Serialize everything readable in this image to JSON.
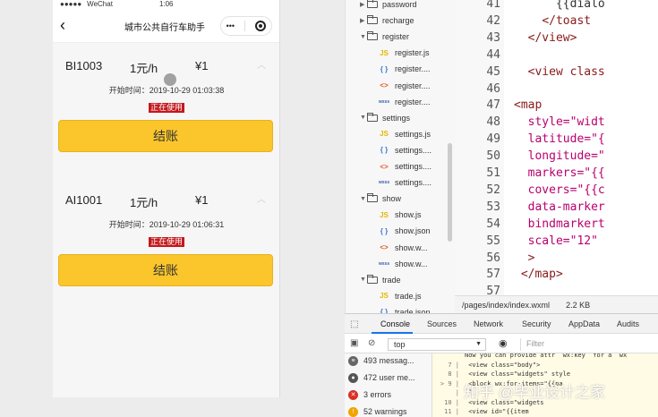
{
  "phone": {
    "status": {
      "carrier": "WeChat",
      "time": "1:06",
      "battery": ""
    },
    "nav": {
      "back_glyph": "‹",
      "title": "城市公共自行车助手",
      "more_glyph": "•••"
    },
    "cards": [
      {
        "id": "BI1003",
        "price": "1元/h",
        "amount": "¥1",
        "start": "开始时间：2019-10-29 01:03:38",
        "status": "正在使用",
        "button": "结账"
      },
      {
        "id": "AI1001",
        "price": "1元/h",
        "amount": "¥1",
        "start": "开始时间：2019-10-29 01:06:31",
        "status": "正在使用",
        "button": "结账"
      }
    ]
  },
  "filetree": [
    {
      "label": "password",
      "kind": "folder",
      "open": false
    },
    {
      "label": "recharge",
      "kind": "folder",
      "open": false
    },
    {
      "label": "register",
      "kind": "folder",
      "open": true
    },
    {
      "label": "register.js",
      "kind": "js"
    },
    {
      "label": "register....",
      "kind": "json"
    },
    {
      "label": "register....",
      "kind": "wxml"
    },
    {
      "label": "register....",
      "kind": "wxss"
    },
    {
      "label": "settings",
      "kind": "folder",
      "open": true
    },
    {
      "label": "settings.js",
      "kind": "js"
    },
    {
      "label": "settings....",
      "kind": "json"
    },
    {
      "label": "settings....",
      "kind": "wxml"
    },
    {
      "label": "settings....",
      "kind": "wxss"
    },
    {
      "label": "show",
      "kind": "folder",
      "open": true
    },
    {
      "label": "show.js",
      "kind": "js"
    },
    {
      "label": "show.json",
      "kind": "json"
    },
    {
      "label": "show.w...",
      "kind": "wxml"
    },
    {
      "label": "show.w...",
      "kind": "wxss"
    },
    {
      "label": "trade",
      "kind": "folder",
      "open": true
    },
    {
      "label": "trade.js",
      "kind": "js"
    },
    {
      "label": "trade.json",
      "kind": "json"
    }
  ],
  "file_icons": {
    "js": "JS",
    "json": "{ }",
    "wxml": "<>",
    "wxss": "wxss"
  },
  "editor": {
    "lines": [
      {
        "n": "41",
        "indent": "      ",
        "parts": [
          {
            "t": "{{dialo",
            "c": "brace"
          }
        ]
      },
      {
        "n": "42",
        "indent": "    ",
        "parts": [
          {
            "t": "</toast",
            "c": "tag"
          }
        ]
      },
      {
        "n": "43",
        "indent": "  ",
        "parts": [
          {
            "t": "</view>",
            "c": "tag"
          }
        ]
      },
      {
        "n": "44",
        "indent": "",
        "parts": []
      },
      {
        "n": "45",
        "indent": "  ",
        "parts": [
          {
            "t": "<view class",
            "c": "tag"
          }
        ]
      },
      {
        "n": "46",
        "indent": "",
        "parts": []
      },
      {
        "n": "47",
        "indent": "",
        "parts": [
          {
            "t": "<map",
            "c": "tag"
          }
        ]
      },
      {
        "n": "48",
        "indent": "  ",
        "parts": [
          {
            "t": "style=\"widt",
            "c": "attr"
          }
        ]
      },
      {
        "n": "49",
        "indent": "  ",
        "parts": [
          {
            "t": "latitude=\"{",
            "c": "attr"
          }
        ]
      },
      {
        "n": "50",
        "indent": "  ",
        "parts": [
          {
            "t": "longitude=\"",
            "c": "attr"
          }
        ]
      },
      {
        "n": "51",
        "indent": "  ",
        "parts": [
          {
            "t": "markers=\"{{",
            "c": "attr"
          }
        ]
      },
      {
        "n": "52",
        "indent": "  ",
        "parts": [
          {
            "t": "covers=\"{{c",
            "c": "attr"
          }
        ]
      },
      {
        "n": "53",
        "indent": "  ",
        "parts": [
          {
            "t": "data-marker",
            "c": "attr"
          }
        ]
      },
      {
        "n": "54",
        "indent": "  ",
        "parts": [
          {
            "t": "bindmarkert",
            "c": "attr"
          }
        ]
      },
      {
        "n": "55",
        "indent": "  ",
        "parts": [
          {
            "t": "scale=\"12\"",
            "c": "attr"
          }
        ]
      },
      {
        "n": "56",
        "indent": "  ",
        "parts": [
          {
            "t": ">",
            "c": "tag"
          }
        ]
      },
      {
        "n": "57",
        "indent": " ",
        "parts": [
          {
            "t": "</map>",
            "c": "tag"
          }
        ]
      },
      {
        "n": "57",
        "indent": "",
        "parts": []
      }
    ],
    "path": "/pages/index/index.wxml",
    "size": "2.2 KB"
  },
  "devtools": {
    "tabs": [
      "Console",
      "Sources",
      "Network",
      "Security",
      "AppData",
      "Audits"
    ],
    "active_tab": "Console",
    "context": "top",
    "filter_placeholder": "Filter",
    "messages": [
      {
        "label": "493 messag...",
        "icon": "list",
        "color": "#666666"
      },
      {
        "label": "472 user me...",
        "icon": "user",
        "color": "#555555"
      },
      {
        "label": "3 errors",
        "icon": "error",
        "color": "#d93025"
      },
      {
        "label": "52 warnings",
        "icon": "warning",
        "color": "#f0a500"
      }
    ],
    "console_lines": [
      {
        "n": "",
        "text": "Now you can provide attr `wx:key` for a `wx"
      },
      {
        "n": "7 |",
        "text": "  <view class=\"body\">"
      },
      {
        "n": "8 |",
        "text": "      <view class=\"widgets\"  style"
      },
      {
        "n": "> 9 |",
        "text": "        <block wx:for-items=\"{{pa"
      },
      {
        "n": "|",
        "text": "        ^"
      },
      {
        "n": "10 |",
        "text": "          <view class=\"widgets"
      },
      {
        "n": "11 |",
        "text": "            <view id=\"{{item"
      }
    ]
  },
  "watermark": "知乎 @毕业设计之家"
}
